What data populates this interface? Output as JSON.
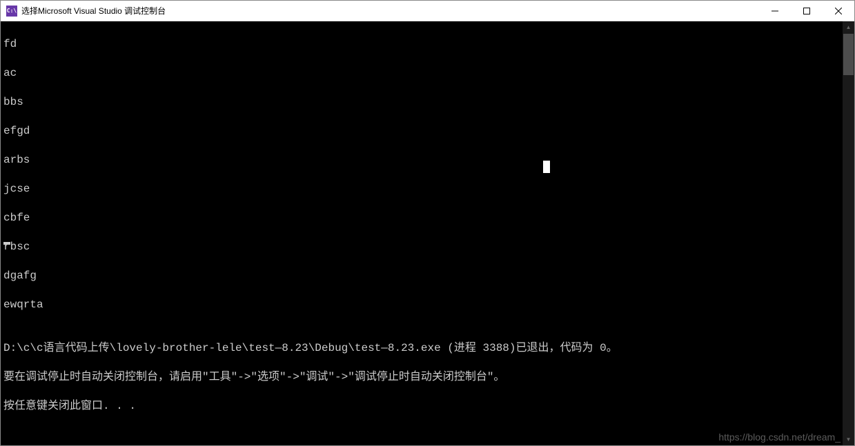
{
  "window": {
    "title": "选择Microsoft Visual Studio 调试控制台",
    "icon_text": "C:\\"
  },
  "console": {
    "output_lines": [
      "fd",
      "ac",
      "bbs",
      "efgd",
      "arbs",
      "jcse",
      "cbfe",
      "rbsc",
      "dgafg",
      "ewqrta"
    ],
    "blank_line": "",
    "exit_line": "D:\\c\\c语言代码上传\\lovely-brother-lele\\test—8.23\\Debug\\test—8.23.exe (进程 3388)已退出，代码为 0。",
    "hint_line": "要在调试停止时自动关闭控制台，请启用\"工具\"->\"选项\"->\"调试\"->\"调试停止时自动关闭控制台\"。",
    "prompt_line": "按任意键关闭此窗口. . ."
  },
  "watermark": "https://blog.csdn.net/dream_"
}
